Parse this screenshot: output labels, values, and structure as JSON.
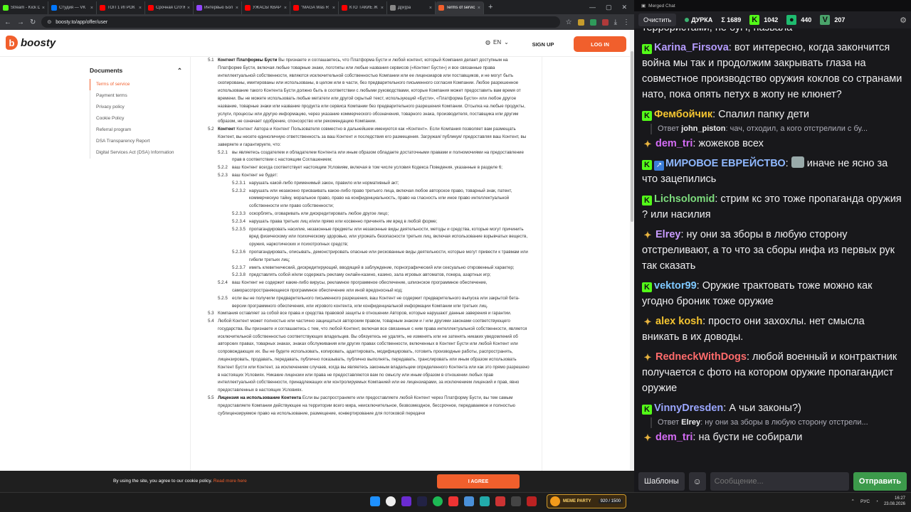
{
  "browser": {
    "tabs": [
      {
        "title": "Stream - Kick D",
        "color": "#53fc18"
      },
      {
        "title": "Студия — VK",
        "color": "#0077ff"
      },
      {
        "title": "ТОП 1 ИГРОК",
        "color": "#ff0000"
      },
      {
        "title": "Срочная СЛУЖ",
        "color": "#ff0000"
      },
      {
        "title": "Интервью Бол",
        "color": "#9146ff"
      },
      {
        "title": "УЖАСЫ КВАРТ",
        "color": "#ff0000"
      },
      {
        "title": "\"MAGA Was R",
        "color": "#ff0000"
      },
      {
        "title": "КТО ТАКИЕ Ж",
        "color": "#ff0000"
      },
      {
        "title": "Д(и)ра",
        "color": "#888888"
      },
      {
        "title": "Terms of servic",
        "color": "#f15f2c",
        "active": true
      }
    ],
    "new_tab": "+",
    "url": "boosty.to/app/offer/user"
  },
  "site": {
    "logo": "boosty",
    "lang": "EN",
    "signup": "SIGN UP",
    "login": "LOG IN",
    "docs_title": "Documents",
    "docs": [
      "Terms of service",
      "Payment terms",
      "Privacy policy",
      "Cookie Policy",
      "Referral program",
      "DSA Transparency Report",
      "Digital Services Act (DSA) Information"
    ]
  },
  "terms": [
    {
      "level": 1,
      "num": "5.1",
      "head": "Контент Платформы Бусти",
      "text": "Вы признаете и соглашаетесь, что Платформа Бусти и любой контент, который Компания делает доступным на Платформе Бусти, включая любые товарные знаки, логотипы или любые названия сервисов («Контент Бусти») и все связанные права интеллектуальной собственности, являются исключительной собственностью Компании или ее лицензиаров или поставщиков, и не могут быть скопированы, имитированы или использованы, в целом или в части, без предварительного письменного согласия Компании. Любое разрешенное использование такого Контента Бусти должно быть в соответствии с любыми руководствами, которые Компания может предоставить вам время от времени. Вы не можете использовать любые метатеги или другой скрытый текст, использующий «Бусти», «Платформа Бусти» или любое другое название, товарные знаки или название продукта или сервиса Компании без предварительного разрешения Компании. Отсылка на любые продукты, услуги, процессы или другую информацию, через указание коммерческого обозначения, товарного знака, производителя, поставщика или другим образом, не означает одобрение, спонсорство или рекомендацию Компании."
    },
    {
      "level": 1,
      "num": "5.2",
      "head": "Контент",
      "text": "Контент Автора и Контент Пользователя совместно в дальнейшем именуются как «Контент». Если Компания позволяет вам размещать Контент, вы несете единоличную ответственность за ваш Контент и последствия его размещения. Загружая/ публикуя/ предоставляя ваш Контент, вы заверяете и гарантируете, что:"
    },
    {
      "level": 2,
      "num": "5.2.1",
      "text": "вы являетесь создателем и обладателем Контента или иным образом обладаете достаточными правами и полномочиями на предоставление прав в соответствии с настоящим Соглашением;"
    },
    {
      "level": 2,
      "num": "5.2.2",
      "text": "ваш Контент всегда соответствует настоящим Условиям, включая в том числе условия Кодекса Поведения, указанные в разделе 6;"
    },
    {
      "level": 2,
      "num": "5.2.3",
      "text": "ваш Контент не будет:"
    },
    {
      "level": 3,
      "num": "5.2.3.1",
      "text": "нарушать какой-либо применимый закон, правило или нормативный акт;"
    },
    {
      "level": 3,
      "num": "5.2.3.2",
      "text": "нарушать или незаконно присваивать какое-либо право третьего лица, включая любое авторское право, товарный знак, патент, коммерческую тайну, моральное право, право на конфиденциальность, право на гласность или иное право интеллектуальной собственности или право собственности;"
    },
    {
      "level": 3,
      "num": "5.2.3.3",
      "text": "оскорблять, оговаривать или дискредитировать любое другое лицо;"
    },
    {
      "level": 3,
      "num": "5.2.3.4",
      "text": "нарушать права третьих лиц и/или прямо или косвенно причинять им вред в любой форме;"
    },
    {
      "level": 3,
      "num": "5.2.3.5",
      "text": "пропагандировать насилие, незаконные предметы или незаконные виды деятельности, методы и средства, которые могут причинить вред физическому или психическому здоровью, или угрожать безопасности третьих лиц, включая использование взрывчатых веществ, оружия, наркотических и психотропных средств;"
    },
    {
      "level": 3,
      "num": "5.2.3.6",
      "text": "пропагандировать, описывать, демонстрировать опасные или рискованные виды деятельности, которые могут привести к травмам или гибели третьих лиц;"
    },
    {
      "level": 3,
      "num": "5.2.3.7",
      "text": "иметь клеветнический, дискредитирующий, вводящий в заблуждение, порнографический или сексуально откровенный характер;"
    },
    {
      "level": 3,
      "num": "5.2.3.8",
      "text": "представлять собой и/или содержать рекламу онлайн-казино, казино, зала игровых автоматов, покера, азартных игр;"
    },
    {
      "level": 2,
      "num": "5.2.4",
      "text": "ваш Контент не содержит какие-либо вирусы, рекламное программное обеспечение, шпионское программное обеспечение, саморасспространяющееся программное обеспечение или иной вредоносный код;"
    },
    {
      "level": 2,
      "num": "5.2.5",
      "text": "если вы не получили предварительного письменного разрешения, ваш Контент не содержит предварительного выпуска или закрытой бета-версии программного обеспечения, или игрового контента, или конфиденциальной информации Компании или третьих лиц."
    },
    {
      "level": 1,
      "num": "5.3",
      "text": "Компания оставляет за собой все права и средства правовой защиты в отношении Авторов, которые нарушают данные заверения и гарантии."
    },
    {
      "level": 1,
      "num": "5.4",
      "text": "Любой Контент может полностью или частично защищаться авторским правом, товарным знаком и / или другими законами соответствующего государства. Вы признаете и соглашаетесь с тем, что любой Контент, включая все связанные с ним права интеллектуальной собственности, является исключительной собственностью соответствующих владельцев. Вы обязуетесь не удалять, не изменять или не затенять никаких уведомлений об авторских правах, товарных знаках, знаках обслуживания или других правах собственности, включенных в Контент Бусти или любой Контент или сопровождающих их. Вы не будете использовать, копировать, адаптировать, модифицировать, готовить производные работы, распространять, лицензировать, продавать, передавать, публично показывать, публично выполнять, передавать, транслировать или иным образом использовать Контент Бусти или Контент, за исключением случаев, когда вы являетесь законным владельцем определенного Контента или как это прямо разрешено в настоящих Условиях. Никакие лицензии или права не предоставляются вам по смыслу или иным образом в отношении любых прав интеллектуальной собственности, принадлежащих или контролируемых Компанией или ее лицензиарами, за исключением лицензий и прав, явно предоставленных в настоящих Условиях."
    },
    {
      "level": 1,
      "num": "5.5",
      "head": "Лицензия на использование Контента",
      "text": "Если вы распространяете или предоставляете любой Контент через Платформу Бусти, вы тем самым предоставляете Компании действующее на территории всего мира, неисключительное, безвозмездное, бессрочное, передаваемое и полностью сублицензируемое право на использование, размещение, конвертирование для потоковой передачи"
    }
  ],
  "cookie": {
    "text": "By using the site, you agree to our cookie policy.",
    "link": "Read more here",
    "agree": "I AGREE"
  },
  "chat": {
    "window_title": "Merged Chat",
    "clear": "Очистить",
    "stats": [
      {
        "icon": "live-dot",
        "value": "ДУРКА"
      },
      {
        "icon": "sigma",
        "value": "Σ 1689"
      },
      {
        "icon": "kick",
        "value": "1042"
      },
      {
        "icon": "trovo",
        "value": "440"
      },
      {
        "icon": "vk",
        "value": "207"
      }
    ],
    "top_partial": "террористами, не бугт, назвала",
    "messages": [
      {
        "platform": "kick",
        "user": "Karina_Firsova",
        "color": "#b59cff",
        "text": "вот интересно, когда закончится война мы так и продолжим закрывать глаза на совместное производство оружия коклов со странами нато, пока опять петух в жопу не клюнет?"
      },
      {
        "platform": "kick",
        "user": "Фембойчик",
        "color": "#f4c430",
        "text": "Спалил папку дети"
      },
      {
        "reply_to": "john_piston",
        "reply_text": "чач, отходил, а кого отстрелили с бу..."
      },
      {
        "platform": "mod",
        "user": "dem_tri",
        "color": "#d46cf5",
        "text": "жожеков всех"
      },
      {
        "platform": "kick",
        "user": "МИРОВОЕ ЕВРЕЙСТВО",
        "color": "#8fb8ff",
        "text": "иначе не ясно за что зацепились",
        "emote": true
      },
      {
        "platform": "kick",
        "user": "Lichsolomid",
        "color": "#7ddc7d",
        "text": "стрим кс это тоже пропаганда оружия ? или насилия"
      },
      {
        "platform": "mod",
        "user": "Elrey",
        "color": "#c89bff",
        "text": "ну они за зборы в любую сторону отстреливают, а то что за сборы инфа из первых рук так сказать"
      },
      {
        "platform": "kick",
        "user": "vektor99",
        "color": "#7ec8ff",
        "text": "Оружие трактовать тоже можно как угодно броник тоже оружие"
      },
      {
        "platform": "mod",
        "user": "alex kosh",
        "color": "#f4c430",
        "text": "просто они захохлы. нет смысла вникать в их доводы."
      },
      {
        "platform": "mod",
        "user": "RedneckWithDogs",
        "color": "#ff6b6b",
        "text": "любой военный и контрактник получается с фото на котором оружие пропагандист оружие"
      },
      {
        "platform": "kick",
        "user": "VinnyDresden",
        "color": "#9aa6ff",
        "text": "А чьи законы?)"
      },
      {
        "reply_to": "Elrey",
        "reply_text": "ну они за зборы в любую сторону отстрели..."
      },
      {
        "platform": "mod",
        "user": "dem_tri",
        "color": "#d46cf5",
        "text": "на бусти не собирали"
      }
    ],
    "reply_prefix": "Ответ",
    "templates": "Шаблоны",
    "input_placeholder": "Сообщение...",
    "send": "Отправить"
  },
  "taskbar": {
    "meme_name": "MEME PARTY",
    "meme_count": "920 / 1500",
    "lang": "РУС",
    "time": "16:27",
    "date": "23.08.2026"
  }
}
